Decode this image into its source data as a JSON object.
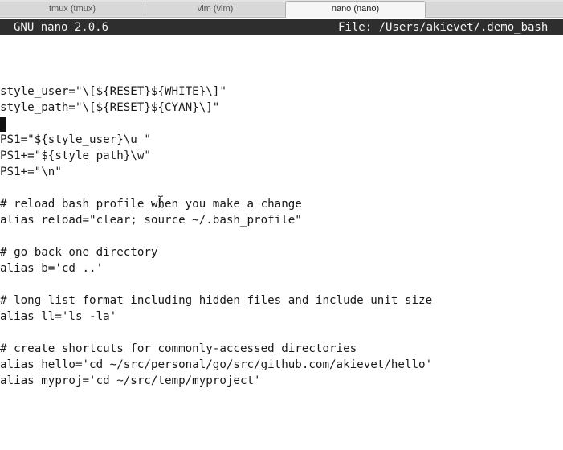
{
  "tabs": [
    {
      "label": "tmux (tmux)"
    },
    {
      "label": "vim (vim)"
    },
    {
      "label": "nano (nano)"
    }
  ],
  "nano": {
    "app_version": "GNU nano 2.0.6",
    "file_label": "File: /Users/akievet/.demo_bash"
  },
  "editor": {
    "lines": [
      "",
      "",
      "",
      "style_user=\"\\[${RESET}${WHITE}\\]\"",
      "style_path=\"\\[${RESET}${CYAN}\\]\"",
      "",
      "PS1=\"${style_user}\\u \"",
      "PS1+=\"${style_path}\\w\"",
      "PS1+=\"\\n\"",
      "",
      "# reload bash profile when you make a change",
      "alias reload=\"clear; source ~/.bash_profile\"",
      "",
      "# go back one directory",
      "alias b='cd ..'",
      "",
      "# long list format including hidden files and include unit size",
      "alias ll='ls -la'",
      "",
      "# create shortcuts for commonly-accessed directories",
      "alias hello='cd ~/src/personal/go/src/github.com/akievet/hello'",
      "alias myproj='cd ~/src/temp/myproject'"
    ]
  }
}
